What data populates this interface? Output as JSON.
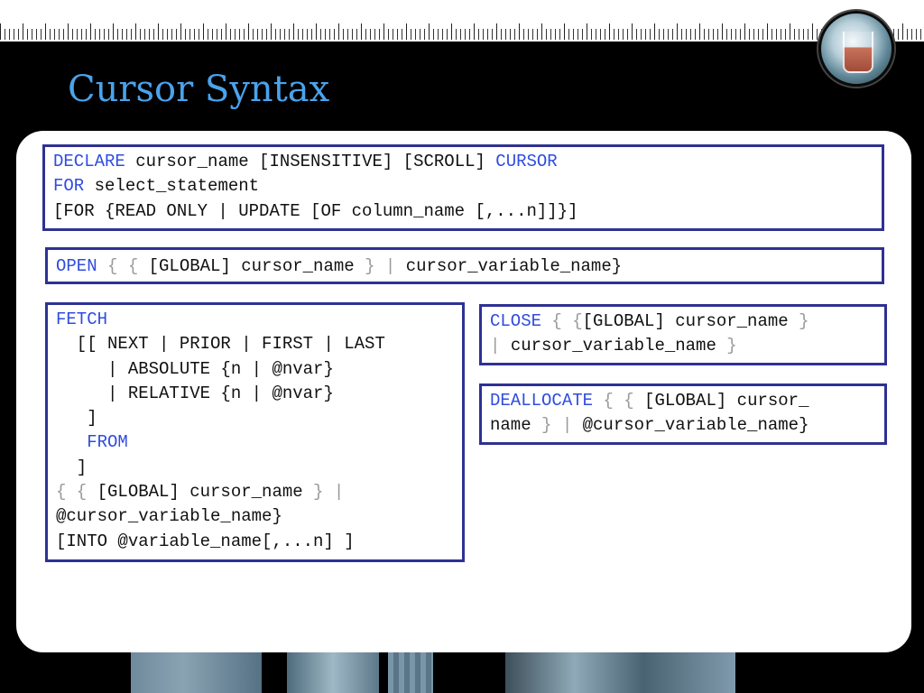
{
  "slide": {
    "title": "Cursor Syntax"
  },
  "declare": {
    "kw_declare": "DECLARE",
    "line1_args": " cursor_name [INSENSITIVE] [SCROLL] ",
    "kw_cursor": "CURSOR",
    "kw_for": "FOR",
    "line2_args": " select_statement",
    "line3": "[FOR {READ ONLY | UPDATE [OF column_name [,...n]]}]"
  },
  "open": {
    "kw_open": "OPEN",
    "brace1": " { { ",
    "arg1": "[GLOBAL] cursor_name",
    "brace2": " } | ",
    "arg2": "cursor_variable_name}"
  },
  "fetch": {
    "kw_fetch": "FETCH",
    "line2": "  [[ NEXT | PRIOR | FIRST | LAST",
    "line3": "     | ABSOLUTE {n | @nvar}",
    "line4": "     | RELATIVE {n | @nvar}",
    "line5": "   ]",
    "kw_from_indent": "   ",
    "kw_from": "FROM",
    "line7": "  ]",
    "brace1": "{ { ",
    "arg1": "[GLOBAL] cursor_name",
    "brace2": " } |",
    "line9": "@cursor_variable_name}",
    "line10": "[INTO @variable_name[,...n] ]"
  },
  "close": {
    "kw_close": "CLOSE",
    "brace1": " { {",
    "arg1": "[GLOBAL] cursor_name",
    "brace2": " }",
    "pipe": "| ",
    "arg2": "cursor_variable_name",
    "brace3": " }"
  },
  "deallocate": {
    "kw_deallocate": "DEALLOCATE",
    "brace1": " { { ",
    "arg1": "[GLOBAL] cursor_",
    "arg1b": "name",
    "brace2": " } | ",
    "arg2": "@cursor_variable_name}"
  },
  "colors": {
    "keyword": "#2f4ce0",
    "punctuation": "#9a9a9a",
    "box_border": "#2e3192",
    "title": "#4aa3ec"
  }
}
